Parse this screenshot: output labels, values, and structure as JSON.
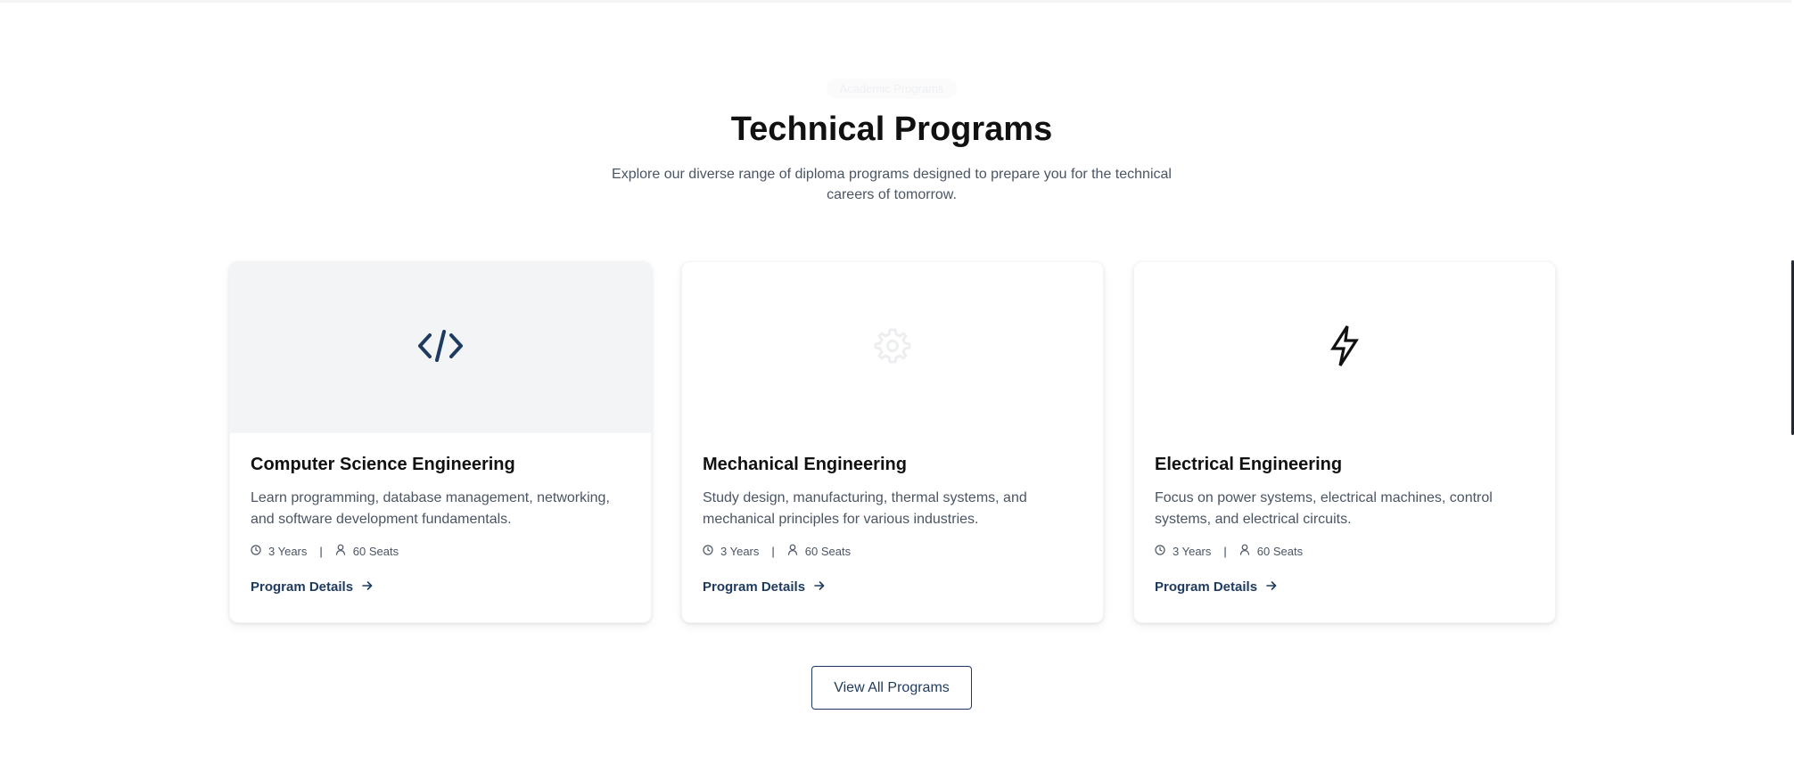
{
  "section": {
    "eyebrow": "Academic Programs",
    "title": "Technical Programs",
    "subtitle": "Explore our diverse range of diploma programs designed to prepare you for the technical careers of tomorrow."
  },
  "programs": [
    {
      "icon": "code-icon",
      "title": "Computer Science Engineering",
      "description": "Learn programming, database management, networking, and software development fundamentals.",
      "duration": "3 Years",
      "seats": "60 Seats",
      "link_label": "Program Details"
    },
    {
      "icon": "gear-icon",
      "title": "Mechanical Engineering",
      "description": "Study design, manufacturing, thermal systems, and mechanical principles for various industries.",
      "duration": "3 Years",
      "seats": "60 Seats",
      "link_label": "Program Details"
    },
    {
      "icon": "lightning-icon",
      "title": "Electrical Engineering",
      "description": "Focus on power systems, electrical machines, control systems, and electrical circuits.",
      "duration": "3 Years",
      "seats": "60 Seats",
      "link_label": "Program Details"
    }
  ],
  "meta_separator": "|",
  "view_all_label": "View All Programs",
  "colors": {
    "accent": "#1e3a5f",
    "text_muted": "#4b5563",
    "featured_media_bg": "#f3f4f6"
  }
}
